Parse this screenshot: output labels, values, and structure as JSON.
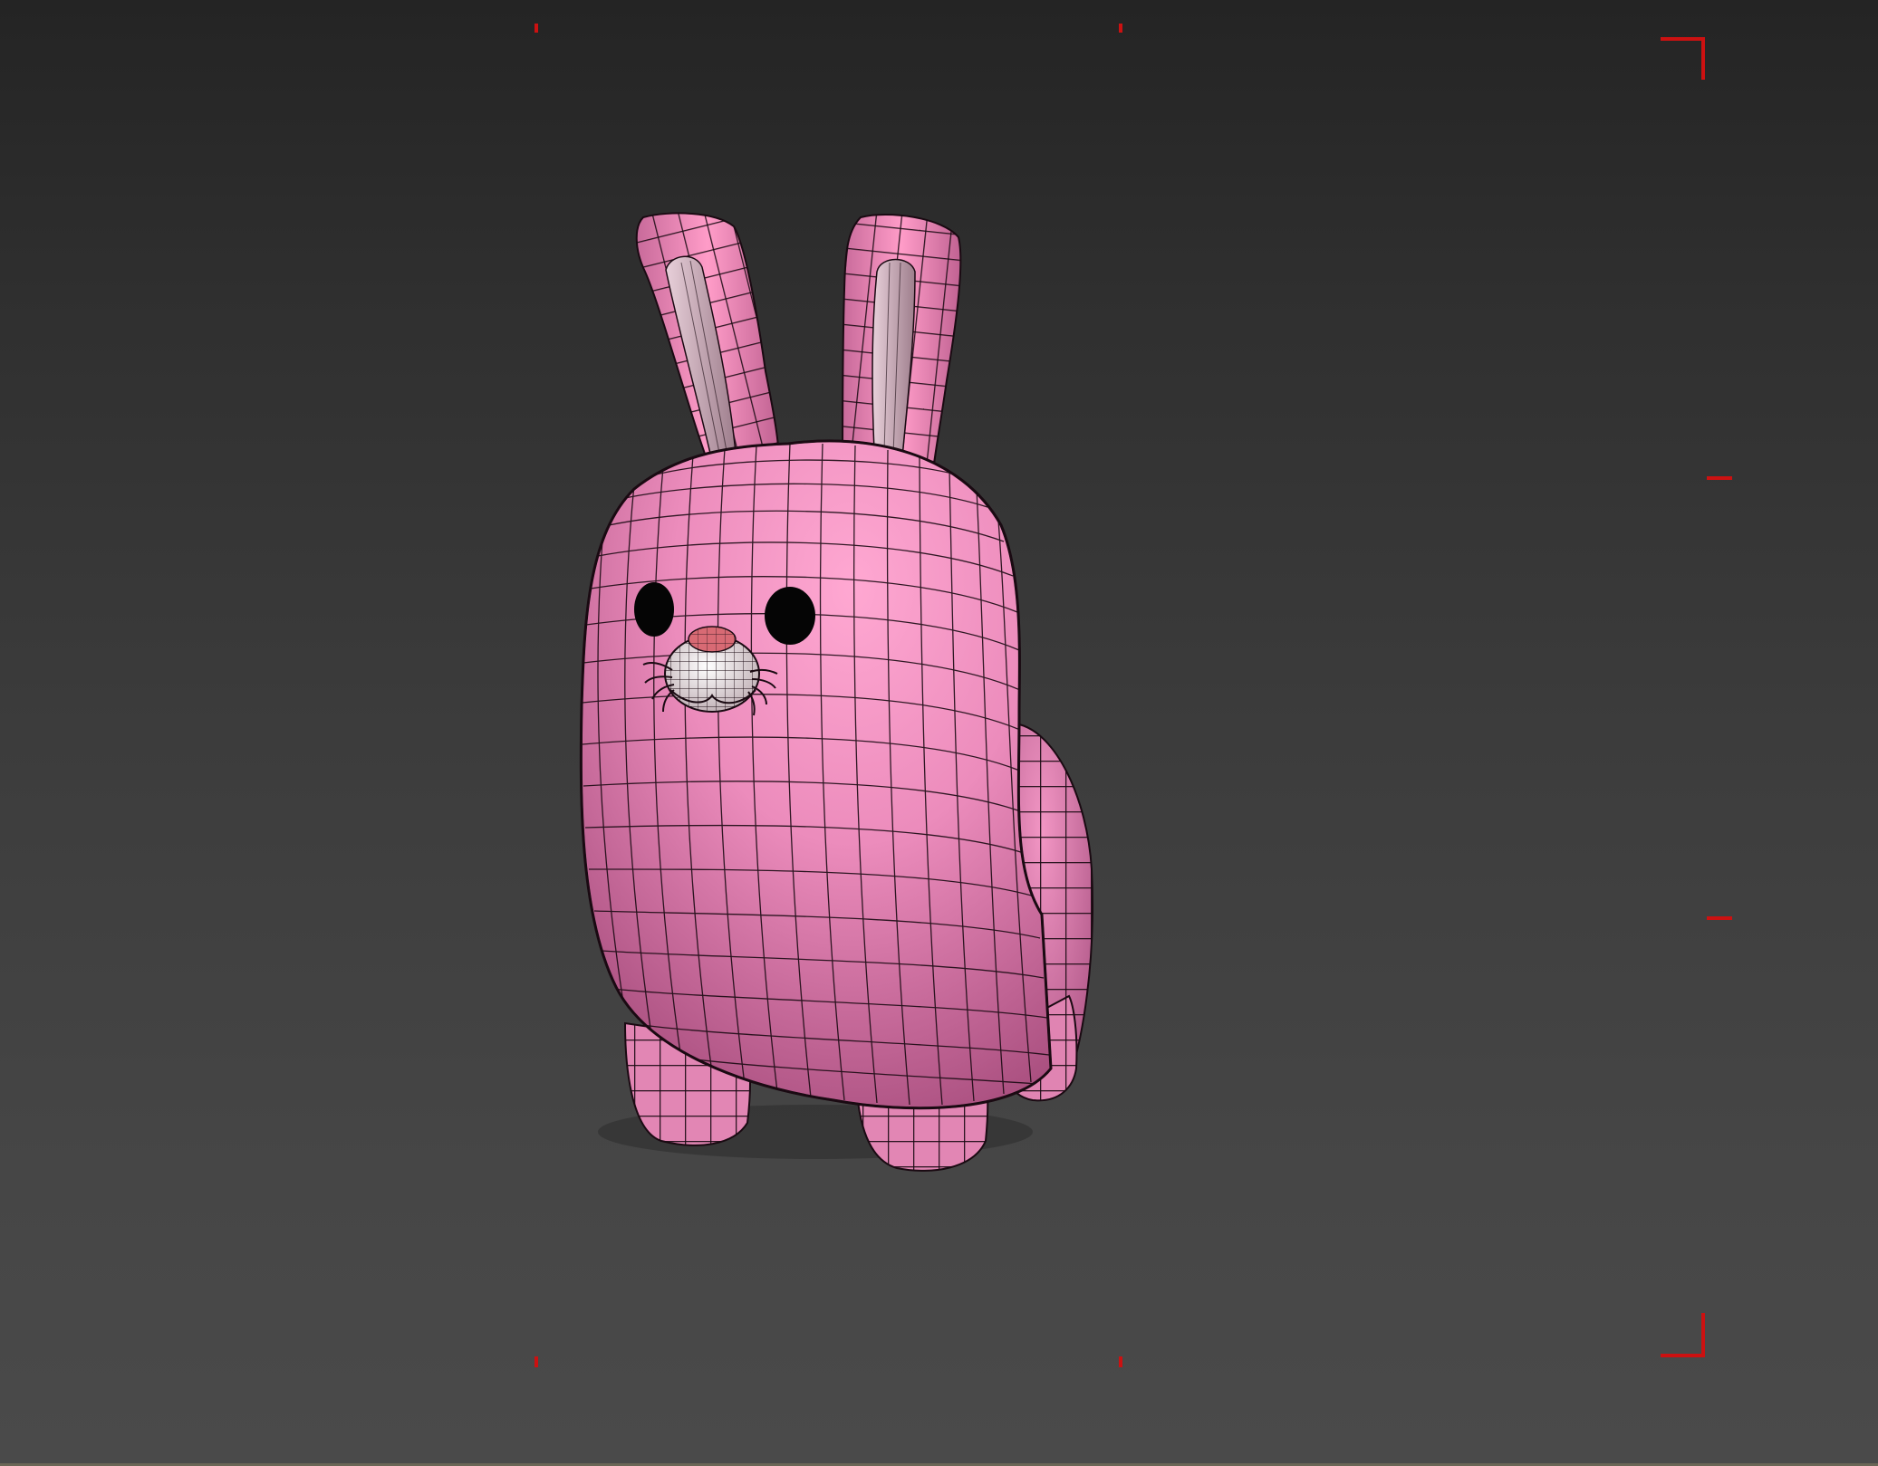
{
  "viewport": {
    "background_top": "#242424",
    "background_bottom": "#4a4a4a",
    "safe_frame_color": "#cc1111"
  },
  "model": {
    "body_color": "#e888b8",
    "highlight_color": "#ffa8d2",
    "shadow_color": "#a84e7e",
    "ear_inner_color": "#c9a4b4",
    "muzzle_color": "#d8c8cc",
    "nose_color": "#d86a74",
    "eye_color": "#050505",
    "wire_color": "#1a0a12"
  }
}
